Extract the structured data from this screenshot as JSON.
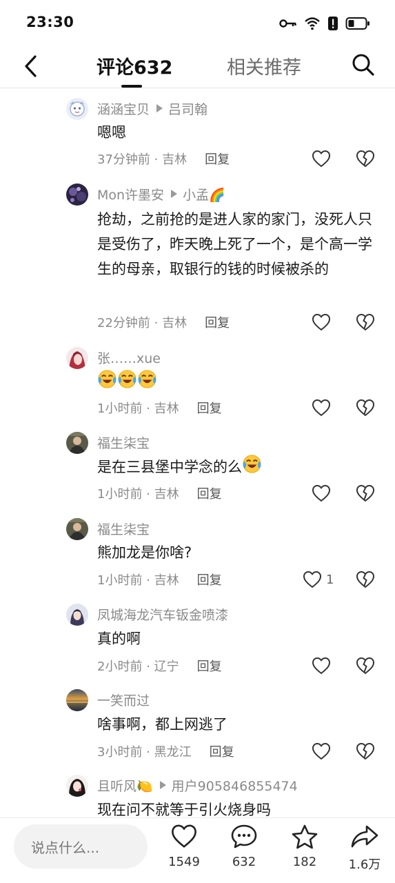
{
  "status": {
    "time": "23:30",
    "icons": [
      "key-icon",
      "wifi-icon",
      "alert-icon",
      "battery-icon"
    ]
  },
  "nav": {
    "tab_comments": "评论632",
    "tab_related": "相关推荐"
  },
  "comments": [
    {
      "user": "涵涵宝贝",
      "reply_to": "吕司翰",
      "text": "嗯嗯",
      "time": "37分钟前 · 吉林",
      "reply": "回复",
      "likes": ""
    },
    {
      "user": "Mon许墨安",
      "reply_to": "小孟🌈",
      "text": "抢劫，之前抢的是进人家的家门，没死人只是受伤了，昨天晚上死了一个，是个高一学生的母亲，取银行的钱的时候被杀的",
      "time": "22分钟前 · 吉林",
      "reply": "回复",
      "likes": ""
    },
    {
      "user": "张……xue",
      "reply_to": "",
      "text": "",
      "time": "1小时前 · 吉林",
      "reply": "回复",
      "likes": "",
      "emoji_count": 3
    },
    {
      "user": "福生柒宝",
      "reply_to": "",
      "text": "是在三县堡中学念的么",
      "time": "1小时前 · 吉林",
      "reply": "回复",
      "likes": "",
      "emoji_count": 1
    },
    {
      "user": "福生柒宝",
      "reply_to": "",
      "text": "熊加龙是你啥?",
      "time": "1小时前 · 吉林",
      "reply": "回复",
      "likes": "1"
    },
    {
      "user": "凤城海龙汽车钣金喷漆",
      "reply_to": "",
      "text": "真的啊",
      "time": "2小时前 · 辽宁",
      "reply": "回复",
      "likes": ""
    },
    {
      "user": "一笑而过",
      "reply_to": "",
      "text": "啥事啊，都上网逃了",
      "time": "3小时前 · 黑龙江",
      "reply": "回复",
      "likes": ""
    },
    {
      "user": "且听风🍋",
      "reply_to": "用户905846855474",
      "text": "现在问不就等于引火烧身吗",
      "time": "",
      "reply": "",
      "likes": ""
    }
  ],
  "bottom": {
    "input_placeholder": "说点什么...",
    "like_count": "1549",
    "comment_count": "632",
    "favorite_count": "182",
    "share_count": "1.6万"
  },
  "colors": {
    "text": "#1a1a1a",
    "muted": "#8a8a8a",
    "divider": "#e6e6e6",
    "input_bg": "#f2f2f2"
  }
}
